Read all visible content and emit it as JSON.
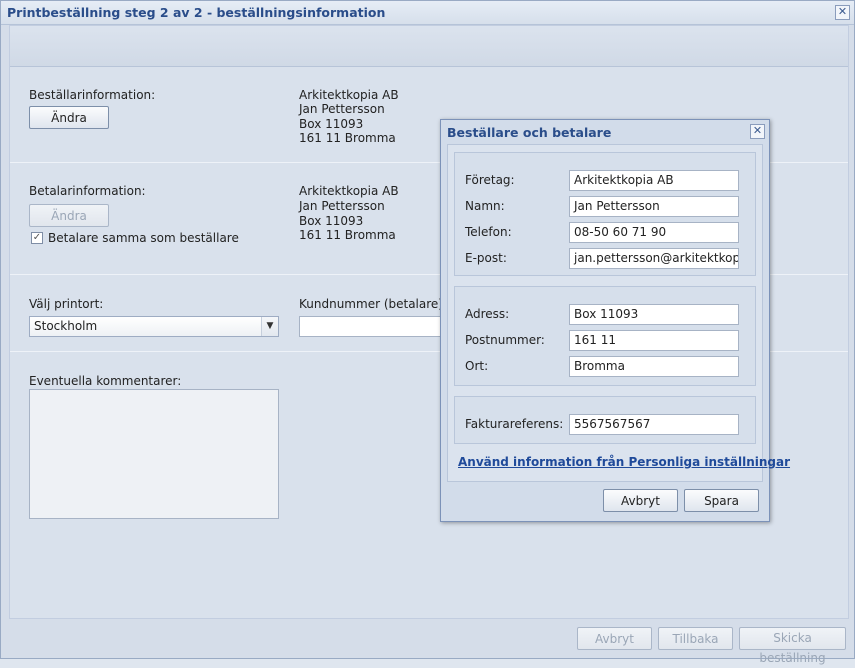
{
  "window": {
    "title": "Printbeställning steg 2 av 2 - beställningsinformation",
    "close_symbol": "✕"
  },
  "orderer": {
    "label": "Beställarinformation:",
    "change_button": "Ändra",
    "address": [
      "Arkitektkopia AB",
      "Jan Pettersson",
      "Box 11093",
      "161 11 Bromma"
    ]
  },
  "payer": {
    "label": "Betalarinformation:",
    "change_button": "Ändra",
    "same_checkbox_label": "Betalare samma som beställare",
    "same_checked": true,
    "check_symbol": "✓",
    "address": [
      "Arkitektkopia AB",
      "Jan Pettersson",
      "Box 11093",
      "161 11 Bromma"
    ]
  },
  "print_location": {
    "label": "Välj printort:",
    "selected": "Stockholm",
    "arrow_symbol": "▼"
  },
  "customer_number": {
    "label": "Kundnummer (betalare):",
    "value": ""
  },
  "comments": {
    "label": "Eventuella kommentarer:",
    "value": ""
  },
  "footer": {
    "cancel": "Avbryt",
    "back": "Tillbaka",
    "send": "Skicka beställning"
  },
  "dialog": {
    "title": "Beställare och betalare",
    "close_symbol": "✕",
    "company_label": "Företag:",
    "company": "Arkitektkopia AB",
    "name_label": "Namn:",
    "name": "Jan Pettersson",
    "phone_label": "Telefon:",
    "phone": "08-50 60 71 90",
    "email_label": "E-post:",
    "email": "jan.pettersson@arkitektkopia.s",
    "address_label": "Adress:",
    "address": "Box 11093",
    "postal_label": "Postnummer:",
    "postal": "161 11",
    "city_label": "Ort:",
    "city": "Bromma",
    "invoice_ref_label": "Fakturareferens:",
    "invoice_ref": "5567567567",
    "use_settings_link": "Använd information från Personliga inställningar",
    "cancel": "Avbryt",
    "save": "Spara"
  }
}
